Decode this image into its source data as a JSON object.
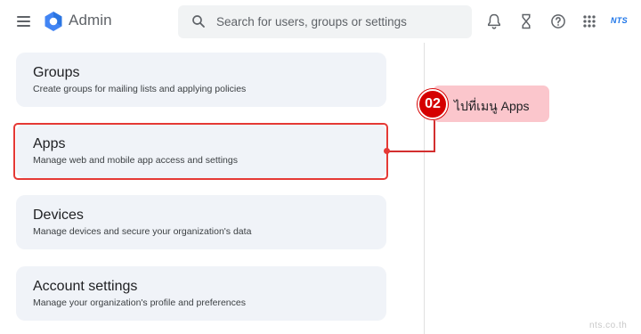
{
  "header": {
    "app_title": "Admin",
    "search_placeholder": "Search for users, groups or settings",
    "brand": "NTS"
  },
  "cards": [
    {
      "title": "Groups",
      "description": "Create groups for mailing lists and applying policies"
    },
    {
      "title": "Apps",
      "description": "Manage web and mobile app access and settings"
    },
    {
      "title": "Devices",
      "description": "Manage devices and secure your organization's data"
    },
    {
      "title": "Account settings",
      "description": "Manage your organization's profile and preferences"
    }
  ],
  "callout": {
    "step_number": "02",
    "text": "ไปที่เมนู Apps"
  },
  "watermark": "nts.co.th",
  "colors": {
    "card_bg": "#f0f3f8",
    "highlight": "#e53935",
    "callout_bg": "#fbc6cc",
    "callout_badge": "#d50000",
    "brand": "#1a73e8"
  }
}
